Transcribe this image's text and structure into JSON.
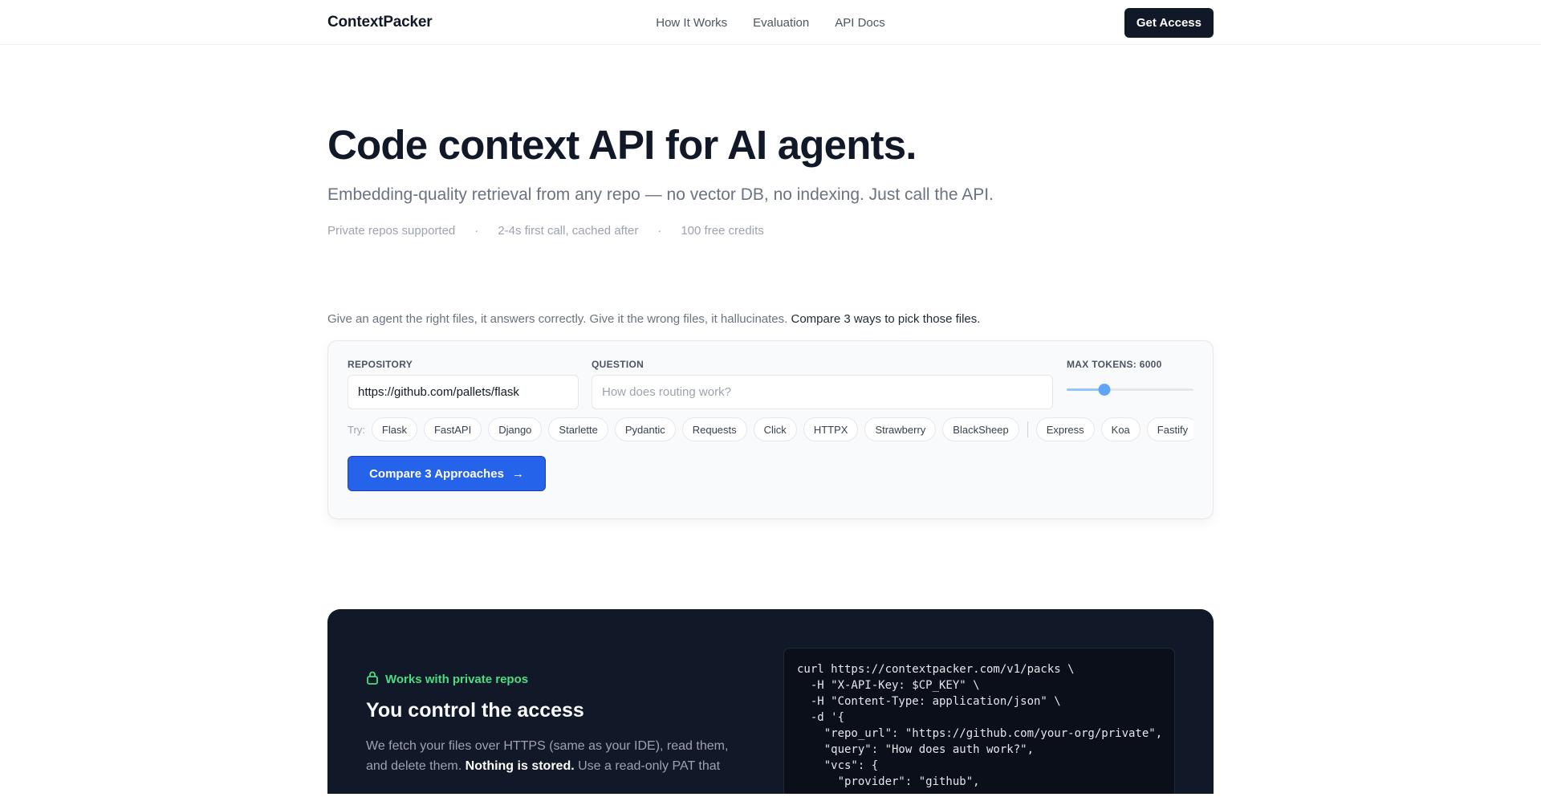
{
  "nav": {
    "brand": "ContextPacker",
    "links": [
      "How It Works",
      "Evaluation",
      "API Docs"
    ],
    "cta": "Get Access"
  },
  "hero": {
    "title": "Code context API for AI agents.",
    "subtitle": "Embedding-quality retrieval from any repo — no vector DB, no indexing. Just call the API.",
    "meta": [
      "Private repos supported",
      "·",
      "2-4s first call, cached after",
      "·",
      "100 free credits"
    ]
  },
  "demo": {
    "intro": "Give an agent the right files, it answers correctly. Give it the wrong files, it hallucinates.",
    "intro_strong": "Compare 3 ways to pick those files.",
    "repo_label": "REPOSITORY",
    "repo_value": "https://github.com/pallets/flask",
    "question_label": "QUESTION",
    "question_placeholder": "How does routing work?",
    "tokens_label": "MAX TOKENS: 6000",
    "tokens_fraction": 0.3,
    "try_label": "Try:",
    "chips_python": [
      "Flask",
      "FastAPI",
      "Django",
      "Starlette",
      "Pydantic",
      "Requests",
      "Click",
      "HTTPX",
      "Strawberry",
      "BlackSheep"
    ],
    "chips_js": [
      "Express",
      "Koa",
      "Fastify"
    ],
    "compare_button": "Compare 3 Approaches",
    "arrow": "→"
  },
  "private": {
    "badge": "Works with private repos",
    "title": "You control the access",
    "text_before": "We fetch your files over HTTPS (same as your IDE), read them, and delete them.",
    "text_bold": "Nothing is stored.",
    "text_after": "Use a read-only PAT that",
    "code": "curl https://contextpacker.com/v1/packs \\\n  -H \"X-API-Key: $CP_KEY\" \\\n  -H \"Content-Type: application/json\" \\\n  -d '{\n    \"repo_url\": \"https://github.com/your-org/private\",\n    \"query\": \"How does auth work?\",\n    \"vcs\": {\n      \"provider\": \"github\","
  },
  "colors": {
    "accent": "#2563eb",
    "dark_bg": "#111827",
    "badge_green": "#4ade80"
  }
}
